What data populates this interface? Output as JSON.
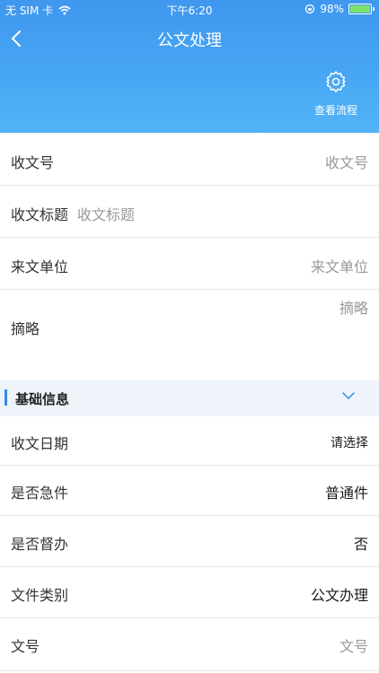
{
  "status_bar": {
    "carrier": "无 SIM 卡",
    "time": "下午6:20",
    "battery": "98%",
    "battery_level": 0.98
  },
  "nav": {
    "title": "公文处理",
    "flow_label": "查看流程"
  },
  "fields": [
    {
      "label": "收文号",
      "value": "收文号"
    },
    {
      "label": "收文标题",
      "value": "收文标题"
    },
    {
      "label": "来文单位",
      "value": "来文单位"
    },
    {
      "label": "摘略",
      "value": "摘略"
    }
  ],
  "section": {
    "title": "基础信息"
  },
  "basic": [
    {
      "label": "收文日期",
      "value": "请选择"
    },
    {
      "label": "是否急件",
      "value": "普通件"
    },
    {
      "label": "是否督办",
      "value": "否"
    },
    {
      "label": "文件类别",
      "value": "公文办理"
    },
    {
      "label": "文号",
      "value": "文号"
    }
  ],
  "colors": {
    "header_top": "#3f97ee",
    "header_bottom": "#52b4f7",
    "accent": "#2f8de8",
    "section_bg": "#eef4f9"
  }
}
